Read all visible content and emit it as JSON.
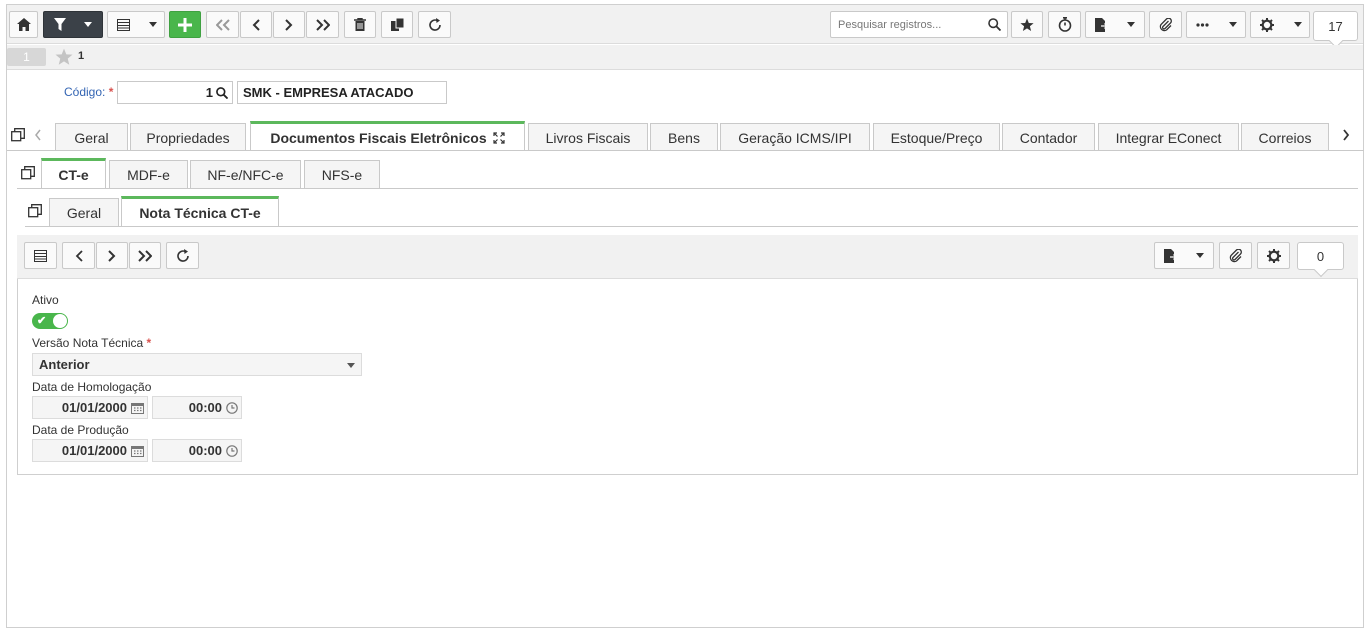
{
  "toolbar": {
    "search_placeholder": "Pesquisar registros...",
    "record_count": "17"
  },
  "record": {
    "index": "1",
    "favorite_label": "1"
  },
  "form": {
    "codigo_label": "Código:",
    "codigo_value": "1",
    "codigo_desc": "SMK - EMPRESA ATACADO"
  },
  "tabs": [
    {
      "label": "Geral"
    },
    {
      "label": "Propriedades"
    },
    {
      "label": "Documentos Fiscais Eletrônicos"
    },
    {
      "label": "Livros Fiscais"
    },
    {
      "label": "Bens"
    },
    {
      "label": "Geração ICMS/IPI"
    },
    {
      "label": "Estoque/Preço"
    },
    {
      "label": "Contador"
    },
    {
      "label": "Integrar EConect"
    },
    {
      "label": "Correios"
    }
  ],
  "subtabs": [
    {
      "label": "CT-e"
    },
    {
      "label": "MDF-e"
    },
    {
      "label": "NF-e/NFC-e"
    },
    {
      "label": "NFS-e"
    }
  ],
  "subsubtabs": [
    {
      "label": "Geral"
    },
    {
      "label": "Nota Técnica CT-e"
    }
  ],
  "subtoolbar": {
    "record_count": "0"
  },
  "fields": {
    "ativo_label": "Ativo",
    "versao_label": "Versão Nota Técnica",
    "versao_value": "Anterior",
    "homologacao_label": "Data de Homologação",
    "homologacao_date": "01/01/2000",
    "homologacao_time": "00:00",
    "producao_label": "Data de Produção",
    "producao_date": "01/01/2000",
    "producao_time": "00:00"
  },
  "colors": {
    "accent": "#49b64b",
    "tab_active_border": "#5cb85c",
    "dark_button": "#3b4148",
    "label_blue": "#3465b3",
    "required": "#d9534f"
  }
}
